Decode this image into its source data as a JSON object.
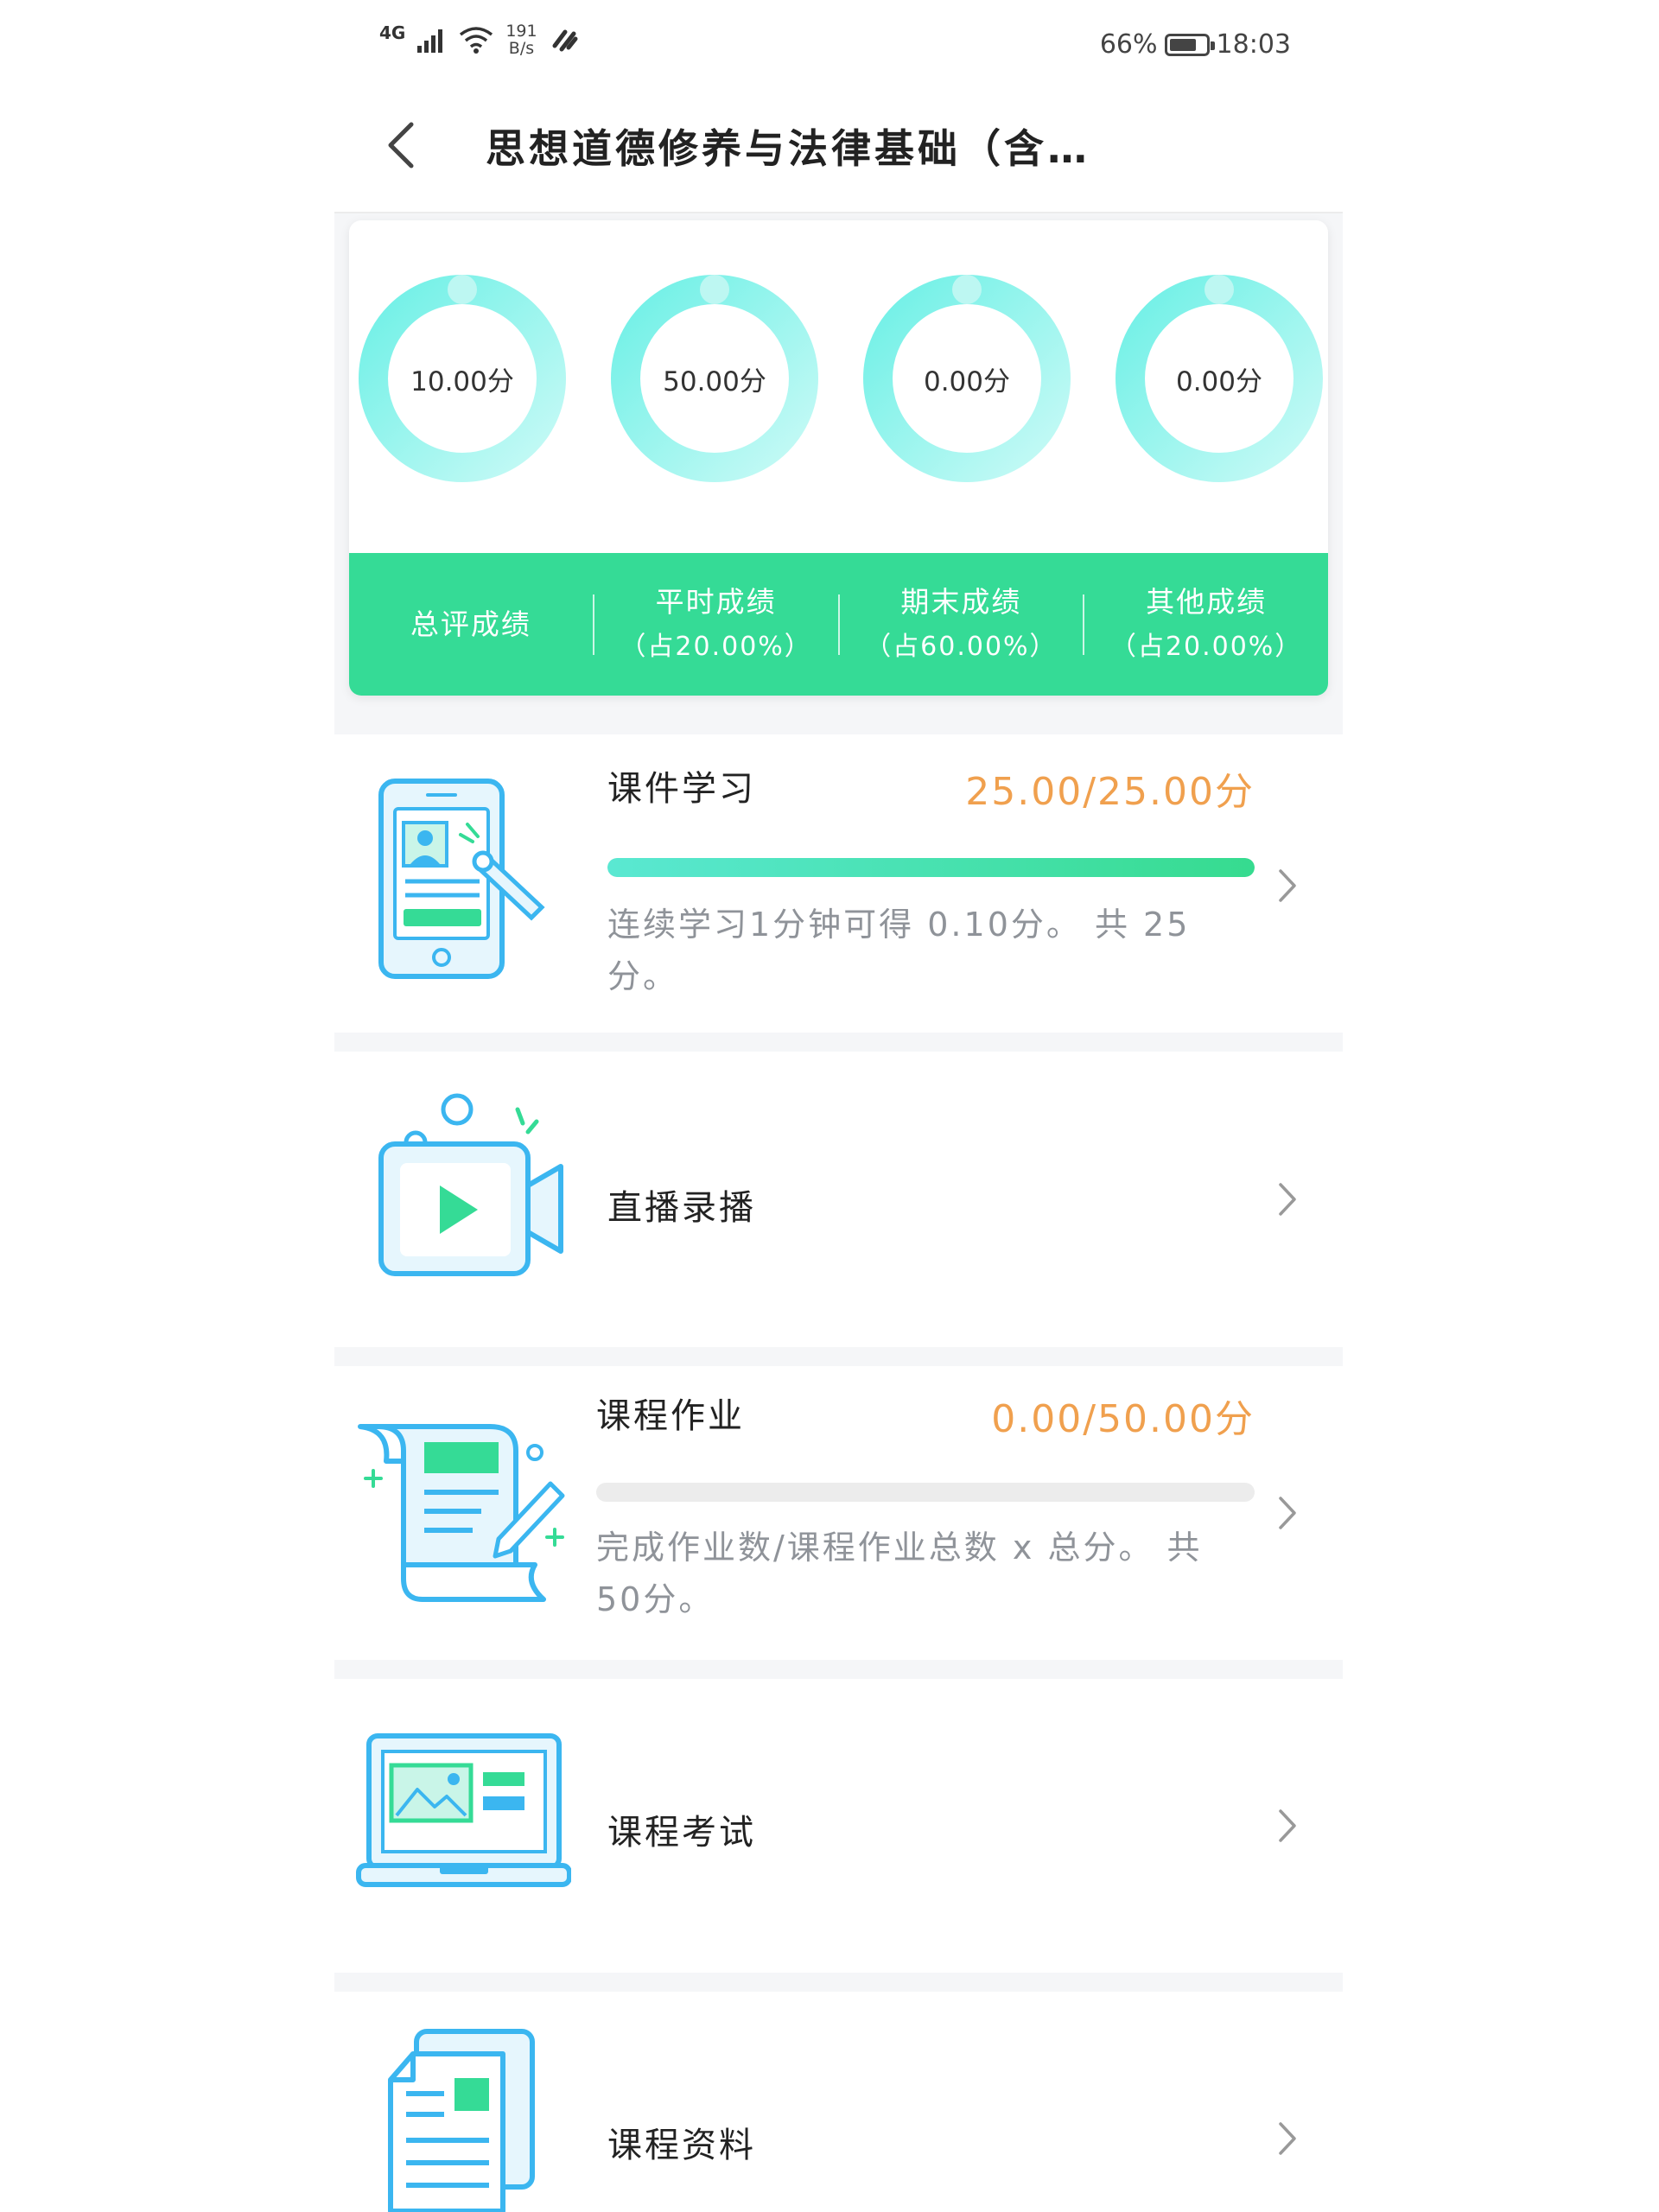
{
  "status_bar": {
    "network": "4G",
    "speed_value": "191",
    "speed_unit": "B/s",
    "battery": "66%",
    "time": "18:03"
  },
  "header": {
    "title": "思想道德修养与法律基础（含实…"
  },
  "scores": {
    "rings": [
      {
        "label": "10.00分"
      },
      {
        "label": "50.00分"
      },
      {
        "label": "0.00分"
      },
      {
        "label": "0.00分"
      }
    ],
    "tabs": [
      {
        "title": "总评成绩",
        "sub": ""
      },
      {
        "title": "平时成绩",
        "sub": "（占20.00%）"
      },
      {
        "title": "期末成绩",
        "sub": "（占60.00%）"
      },
      {
        "title": "其他成绩",
        "sub": "（占20.00%）"
      }
    ]
  },
  "items": {
    "courseware": {
      "title": "课件学习",
      "score": "25.00/25.00分",
      "progress": 1.0,
      "desc": "连续学习1分钟可得 0.10分。 共 25分。"
    },
    "live": {
      "title": "直播录播"
    },
    "homework": {
      "title": "课程作业",
      "score": "0.00/50.00分",
      "progress": 0.0,
      "desc": "完成作业数/课程作业总数 x 总分。 共 50分。"
    },
    "exam": {
      "title": "课程考试"
    },
    "materials": {
      "title": "课程资料"
    }
  },
  "colors": {
    "accent_green": "#35db96",
    "ring_cyan": "#6ef0e6",
    "score_orange": "#f0a04e",
    "icon_blue": "#3bb6f0"
  }
}
